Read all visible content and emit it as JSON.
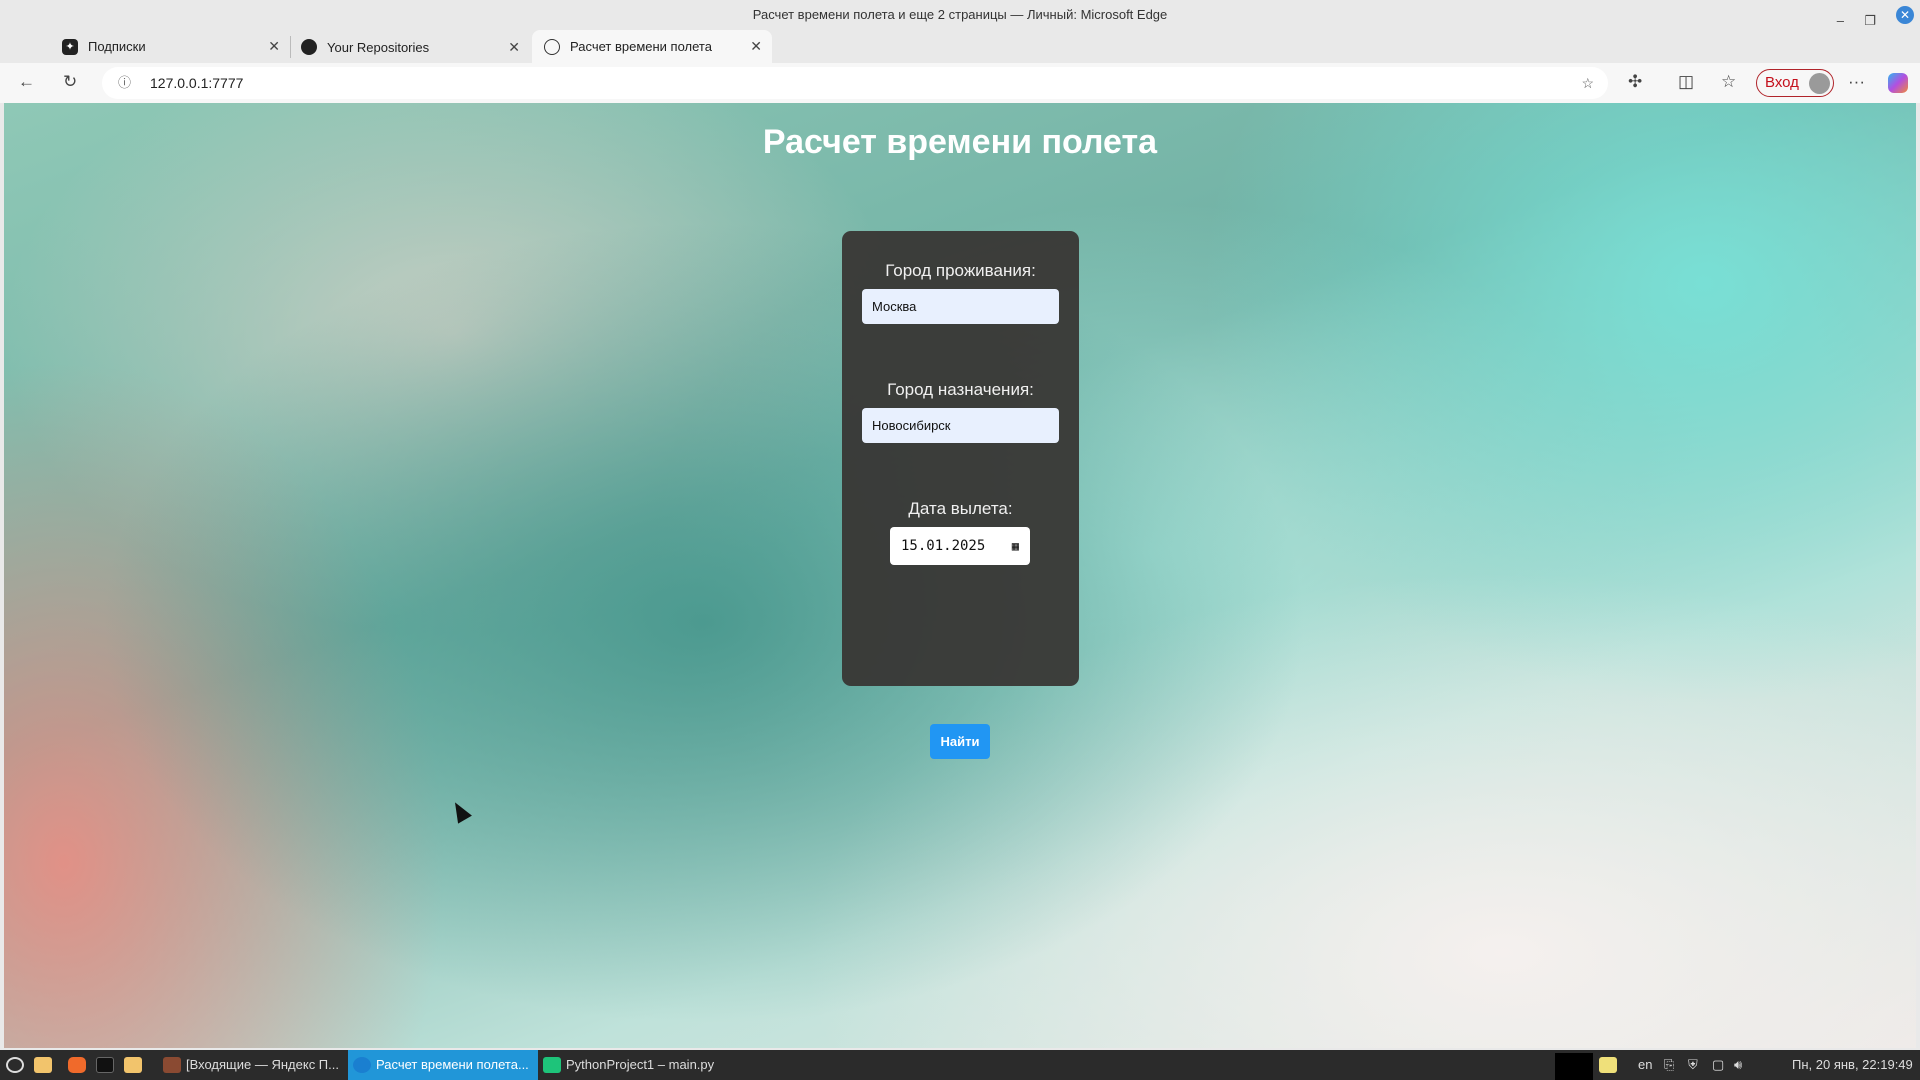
{
  "window": {
    "title": "Расчет времени полета и еще 2 страницы — Личный: Microsoft Edge"
  },
  "tabs": [
    {
      "label": "Подписки",
      "icon": "sparkle-icon"
    },
    {
      "label": "Your Repositories",
      "icon": "github-icon"
    },
    {
      "label": "Расчет времени полета",
      "icon": "globe-icon",
      "active": true
    }
  ],
  "address": {
    "url": "127.0.0.1:7777"
  },
  "toolbar": {
    "login_label": "Вход"
  },
  "page": {
    "title": "Расчет времени полета",
    "origin_label": "Город проживания:",
    "origin_value": "Москва",
    "dest_label": "Город назначения:",
    "dest_value": "Новосибирск",
    "date_label": "Дата вылета:",
    "date_value": "15.01.2025",
    "submit_label": "Найти"
  },
  "taskbar": {
    "apps": [
      {
        "label": "[Входящие — Яндекс П..."
      },
      {
        "label": "Расчет времени полета...",
        "active": true
      },
      {
        "label": "PythonProject1 – main.py"
      }
    ],
    "lang": "en",
    "clock": "Пн, 20 янв, 22:19:49"
  },
  "colors": {
    "accent": "#2196f3",
    "card": "#373432",
    "login": "#c4101c"
  }
}
